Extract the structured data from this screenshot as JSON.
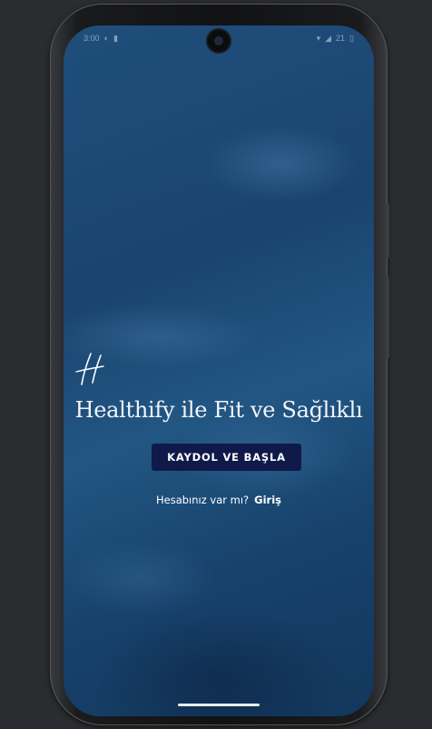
{
  "status_bar": {
    "time": "3:00",
    "battery": "21"
  },
  "splash": {
    "logo_icon": "healthify-h-logo",
    "headline": "Healthify ile Fit ve Sağlıklı",
    "signup_button": "KAYDOL VE BAŞLA",
    "login_prompt": "Hesabınız var mı?",
    "login_link": "Giriş"
  },
  "colors": {
    "background": "#1a4470",
    "button": "#0f1a4a",
    "text": "#ffffff"
  }
}
